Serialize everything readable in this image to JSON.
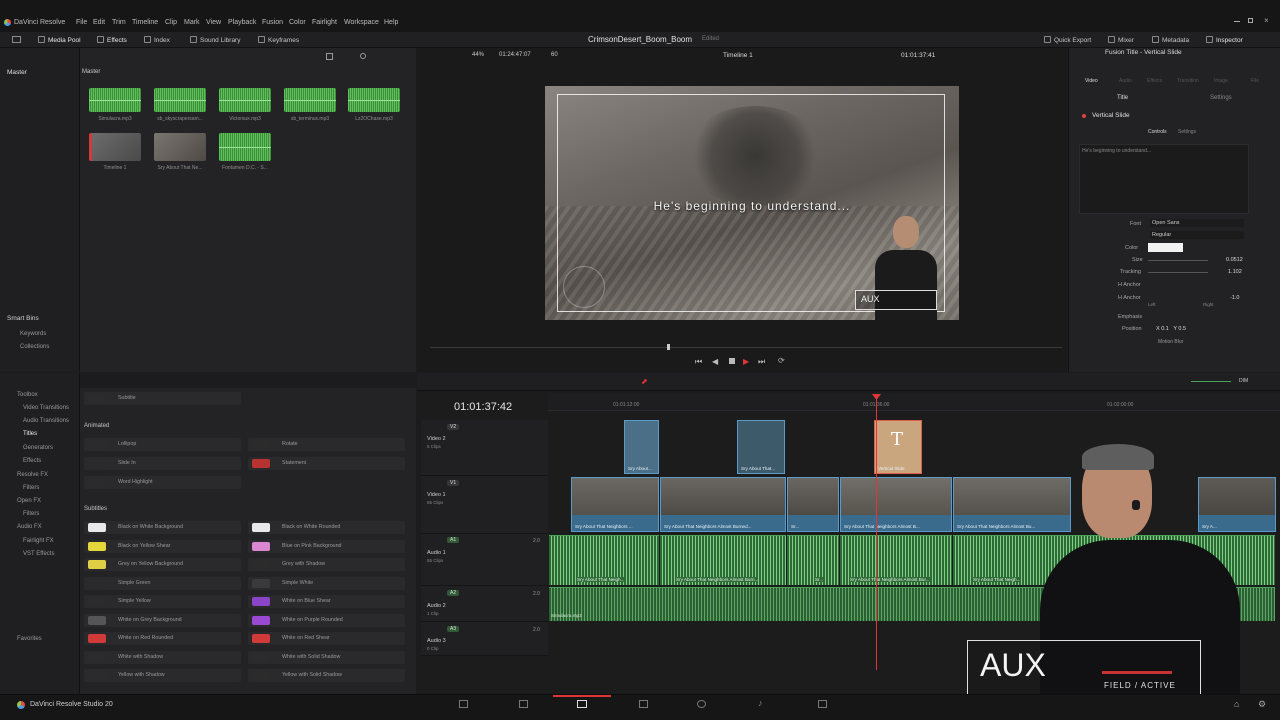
{
  "menubar": {
    "app": "DaVinci Resolve",
    "items": [
      "File",
      "Edit",
      "Trim",
      "Timeline",
      "Clip",
      "Mark",
      "View",
      "Playback",
      "Fusion",
      "Color",
      "Fairlight",
      "Workspace",
      "Help"
    ]
  },
  "toolbar": {
    "media_pool": "Media Pool",
    "effects": "Effects",
    "index": "Index",
    "sound_library": "Sound Library",
    "keyframes": "Keyframes",
    "project": "CrimsonDesert_Boom_Boom",
    "edited": "Edited",
    "quick_export": "Quick Export",
    "mixer": "Mixer",
    "metadata": "Metadata",
    "inspector": "Inspector"
  },
  "media_pool": {
    "master": "Master",
    "bin_header": "Master",
    "clips": [
      {
        "name": "Simulacra.mp3",
        "kind": "audio"
      },
      {
        "name": "sb_skyscrapersam...",
        "kind": "audio"
      },
      {
        "name": "Victorsux.mp3",
        "kind": "audio"
      },
      {
        "name": "sb_terminus.mp3",
        "kind": "audio"
      },
      {
        "name": "Lz2OChase.mp3",
        "kind": "audio"
      },
      {
        "name": "Timeline 1",
        "kind": "timeline"
      },
      {
        "name": "Sry About That Ne...",
        "kind": "video"
      },
      {
        "name": "Fontamen D.C. - S...",
        "kind": "audio"
      }
    ],
    "smart_bins": "Smart Bins",
    "keywords": "Keywords",
    "collections": "Collections"
  },
  "viewer": {
    "zoom": "44%",
    "timecode_src": "01:24:47:07",
    "fps": "60",
    "timeline_name": "Timeline 1",
    "timecode": "01:01:37:41",
    "subtitle": "He's beginning to understand...",
    "aux": "AUX"
  },
  "inspector": {
    "title": "Fusion Title - Vertical Slide",
    "tabs": [
      "Video",
      "Audio",
      "Effects",
      "Transition",
      "Image",
      "File"
    ],
    "subtabs": [
      "Title",
      "Settings"
    ],
    "section": "Vertical Slide",
    "controls_tabs": [
      "Controls",
      "Settings"
    ],
    "text": "He's beginning to understand...",
    "rows": [
      {
        "label": "Font",
        "value": "Open Sans"
      },
      {
        "label": "",
        "value": "Regular"
      },
      {
        "label": "Color",
        "value": ""
      },
      {
        "label": "Size",
        "value": "0.0512"
      },
      {
        "label": "Tracking",
        "value": "1.102"
      },
      {
        "label": "H Anchor",
        "value": ""
      },
      {
        "label": "H Anchor",
        "value": "-1.0"
      },
      {
        "label": "Emphasis",
        "value": ""
      },
      {
        "label": "Position",
        "value": "X 0.1   Y 0.5"
      }
    ],
    "left": "Left",
    "right": "Right",
    "motion_blur": "Motion Blur"
  },
  "toolbox": {
    "items": [
      "Toolbox",
      "Video Transitions",
      "Audio Transitions",
      "Titles",
      "Generators",
      "Effects",
      "Resolve FX",
      "Filters",
      "Open FX",
      "Filters",
      "Audio FX",
      "Fairlight FX",
      "VST Effects"
    ],
    "favorites": "Favorites"
  },
  "effects": {
    "subtitle": "Subtitle",
    "animated": "Animated",
    "subtitles_header": "Subtitles",
    "animated_items": [
      {
        "left": "Lollipop",
        "right": "Rotate"
      },
      {
        "left": "Slide In",
        "right": "Statement"
      },
      {
        "left": "Word Highlight",
        "right": ""
      }
    ],
    "subtitle_items": [
      {
        "left": "Black on White Background",
        "right": "Black on White Rounded"
      },
      {
        "left": "Black on Yellow Shear",
        "right": "Blue on Pink Background"
      },
      {
        "left": "Grey on Yellow Background",
        "right": "Grey with Shadow"
      },
      {
        "left": "Simple Green",
        "right": "Simple White"
      },
      {
        "left": "Simple Yellow",
        "right": "White on Blue Shear"
      },
      {
        "left": "White on Grey Background",
        "right": "White on Purple Rounded"
      },
      {
        "left": "White on Red Rounded",
        "right": "White on Red Shear"
      },
      {
        "left": "White with Shadow",
        "right": "White with Solid Shadow"
      },
      {
        "left": "Yellow with Shadow",
        "right": "Yellow with Solid Shadow"
      }
    ]
  },
  "timeline": {
    "timecode": "01:01:37:42",
    "ruler": [
      "01:01:12:00",
      "01:01:36:00",
      "01:02:00:00"
    ],
    "tracks": [
      {
        "id": "V2",
        "name": "Video 2",
        "sub": "5 Clips"
      },
      {
        "id": "V1",
        "name": "Video 1",
        "sub": "55 Clips"
      },
      {
        "id": "A1",
        "name": "Audio 1",
        "sub": "55 Clips",
        "level": "2.0"
      },
      {
        "id": "A2",
        "name": "Audio 2",
        "sub": "1 Clip",
        "level": "2.0"
      },
      {
        "id": "A3",
        "name": "Audio 3",
        "sub": "0 Clip",
        "level": "2.0"
      }
    ],
    "v2_clips": [
      "Sry About...",
      "Sry About That...",
      "Vertical Slide"
    ],
    "v1_clips": [
      "Sry About That Neighbors ...",
      "Sry About That Neighbors Almost Burned...",
      "Sr...",
      "Sry About That Neighbors Almost B...",
      "Sry About That Neighbors Almost Bu...",
      "Sry A..."
    ],
    "a1_clips": [
      "Sry About That Neigh...",
      "Sry About That Neighbors Almost Burn...",
      "Sr...",
      "Sry About That Neighbors Almost Bur...",
      "Sry About That Neigh..."
    ],
    "a2_clip": "Simulacra.mp3",
    "volume": "DIM"
  },
  "overlay": {
    "aux": "AUX",
    "status": "FIELD / ACTIVE"
  },
  "bottom": {
    "product": "DaVinci Resolve Studio 20"
  }
}
